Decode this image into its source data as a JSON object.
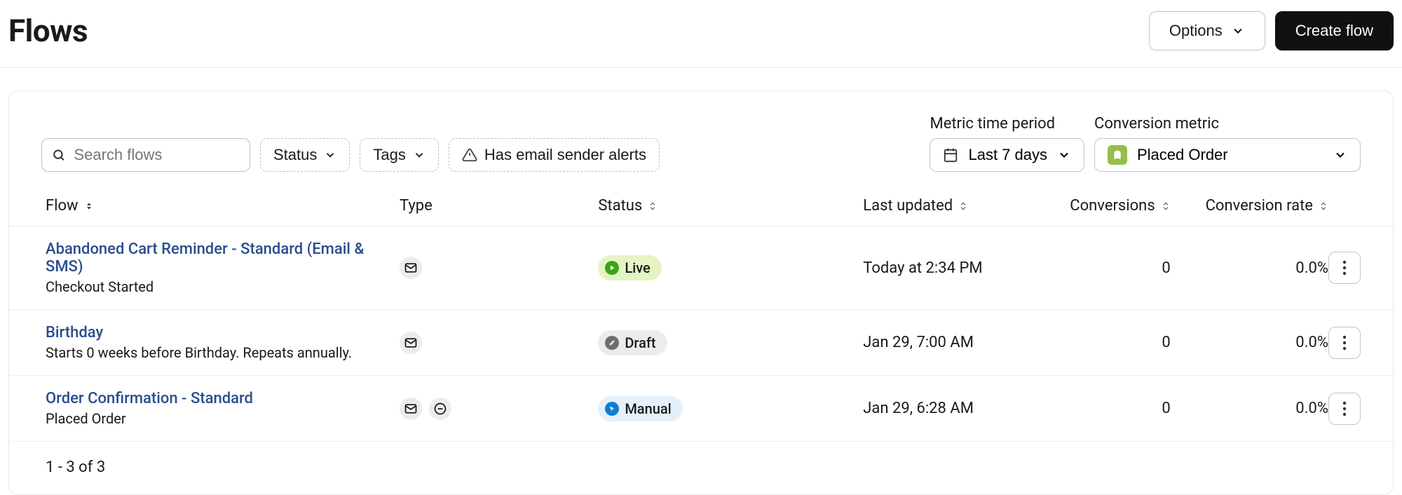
{
  "header": {
    "title": "Flows",
    "options_label": "Options",
    "create_label": "Create flow"
  },
  "filters": {
    "search_placeholder": "Search flows",
    "status_label": "Status",
    "tags_label": "Tags",
    "alerts_label": "Has email sender alerts",
    "metric_time_label": "Metric time period",
    "metric_time_value": "Last 7 days",
    "conversion_metric_label": "Conversion metric",
    "conversion_metric_value": "Placed Order"
  },
  "columns": {
    "flow": "Flow",
    "type": "Type",
    "status": "Status",
    "last_updated": "Last updated",
    "conversions": "Conversions",
    "conversion_rate": "Conversion rate"
  },
  "rows": [
    {
      "name": "Abandoned Cart Reminder - Standard (Email & SMS)",
      "sub": "Checkout Started",
      "types": [
        "email"
      ],
      "status": "Live",
      "status_kind": "live",
      "updated": "Today at 2:34 PM",
      "conversions": "0",
      "rate": "0.0%"
    },
    {
      "name": "Birthday",
      "sub": "Starts 0 weeks before Birthday. Repeats annually.",
      "types": [
        "email"
      ],
      "status": "Draft",
      "status_kind": "draft",
      "updated": "Jan 29, 7:00 AM",
      "conversions": "0",
      "rate": "0.0%"
    },
    {
      "name": "Order Confirmation - Standard",
      "sub": "Placed Order",
      "types": [
        "email",
        "sms"
      ],
      "status": "Manual",
      "status_kind": "manual",
      "updated": "Jan 29, 6:28 AM",
      "conversions": "0",
      "rate": "0.0%"
    }
  ],
  "pagination": "1 - 3 of 3"
}
